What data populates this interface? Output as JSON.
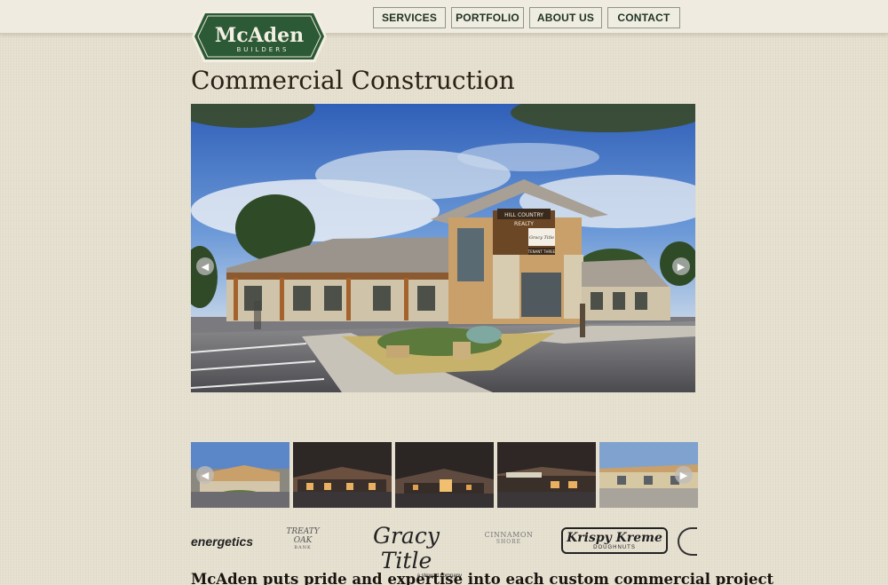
{
  "brand": {
    "name_large": "McAden",
    "name_small": "BUILDERS",
    "logo_color": "#2c5a36"
  },
  "nav": {
    "items": [
      {
        "label": "SERVICES"
      },
      {
        "label": "PORTFOLIO"
      },
      {
        "label": "ABOUT US"
      },
      {
        "label": "CONTACT"
      }
    ]
  },
  "page": {
    "title": "Commercial Construction",
    "tagline": "McAden puts pride and expertise into each custom commercial project"
  },
  "hero": {
    "sign_line1": "HILL COUNTRY",
    "sign_line2": "REALTY",
    "sign_line3": "Gracy Title",
    "sign_line4": "TENANT THREE",
    "prev_icon": "arrow-left-icon",
    "next_icon": "arrow-right-icon"
  },
  "client_logos": [
    {
      "text": "energetics"
    },
    {
      "text": "TREATY OAK",
      "sub": "BANK"
    },
    {
      "text": "Gracy Title",
      "sub": "a stewart company"
    },
    {
      "text": "CINNAMON",
      "sub": "SHORE"
    },
    {
      "text": "Krispy Kreme",
      "sub": "DOUGHNUTS"
    }
  ],
  "colors": {
    "accent_green": "#2c5a36",
    "nav_text": "#1f3322",
    "background": "#e6e0d0"
  }
}
